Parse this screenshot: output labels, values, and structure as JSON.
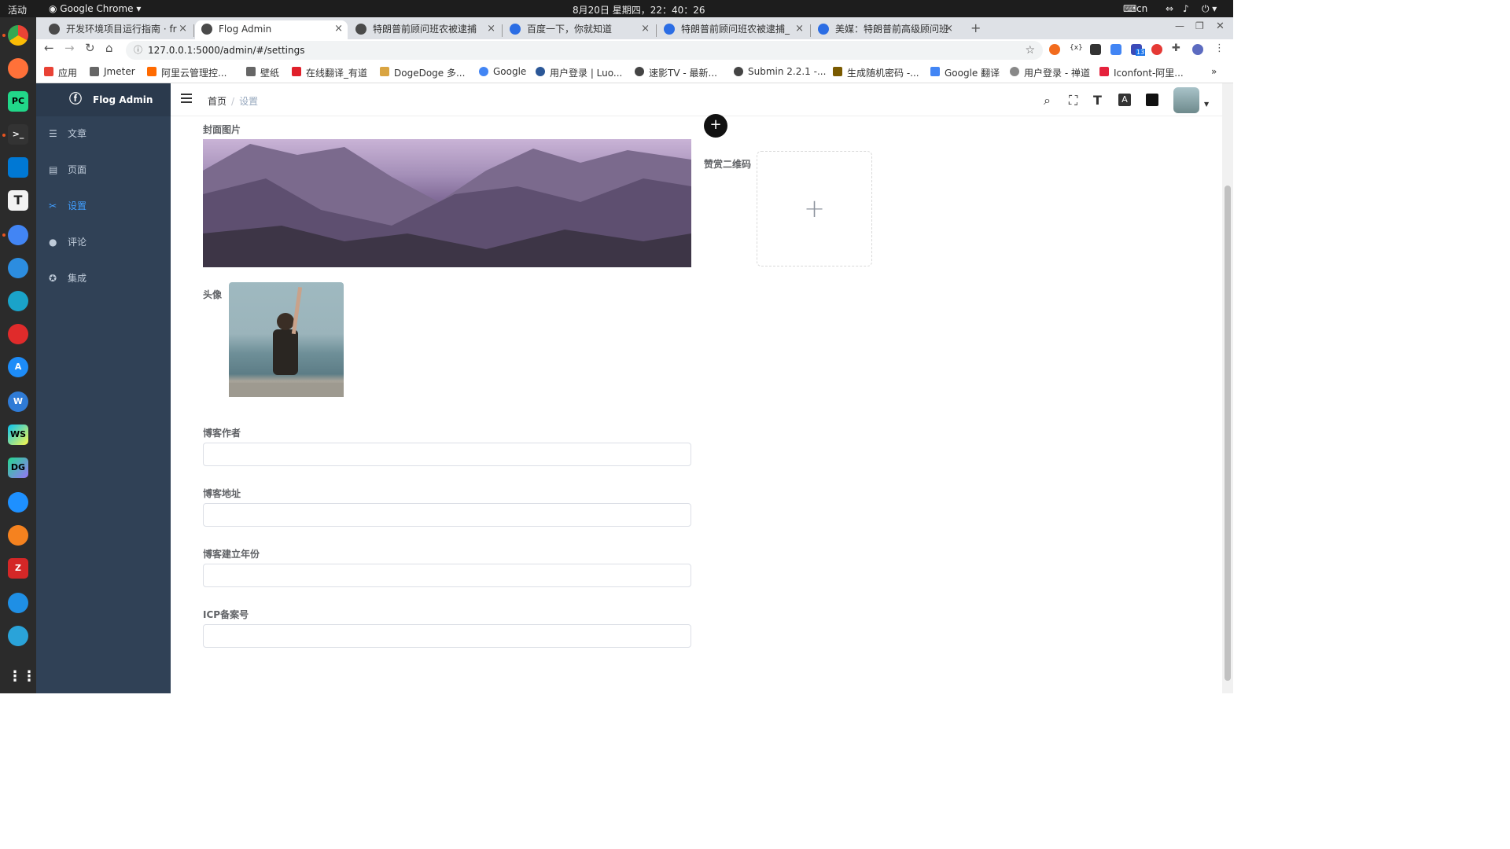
{
  "os": {
    "activities": "活动",
    "app_name": "Google Chrome",
    "clock": "8月20日 星期四，22：40：26",
    "lang": "cn"
  },
  "dock": {
    "items": [
      "chrome",
      "firefox",
      "pycharm",
      "terminal",
      "vscode",
      "typora",
      "chrome-dev",
      "baidu-netdisk",
      "app",
      "netease-music",
      "app-store",
      "webstorm-alt",
      "webstorm",
      "datagrip",
      "feishu",
      "app",
      "filezilla",
      "app",
      "app",
      "app-grid"
    ],
    "labels": {
      "pycharm": "PC",
      "webstorm": "WS",
      "datagrip": "DG",
      "typora": "T"
    }
  },
  "browser": {
    "tabs": [
      {
        "title": "开发环境项目运行指南 · fr",
        "active": false
      },
      {
        "title": "Flog Admin",
        "active": true
      },
      {
        "title": "特朗普前顾问班农被逮捕",
        "active": false
      },
      {
        "title": "百度一下，你就知道",
        "active": false
      },
      {
        "title": "特朗普前顾问班农被逮捕_",
        "active": false
      },
      {
        "title": "美媒：特朗普前高级顾问班",
        "active": false
      }
    ],
    "url": "127.0.0.1:5000/admin/#/settings",
    "bookmarks": [
      "应用",
      "Jmeter",
      "阿里云管理控...",
      "壁纸",
      "在线翻译_有道",
      "DogeDoge 多...",
      "Google",
      "用户登录 | Luo...",
      "速影TV - 最新...",
      "Submin 2.2.1 -...",
      "生成随机密码 -...",
      "Google 翻译",
      "用户登录 - 禅道",
      "Iconfont-阿里..."
    ],
    "badge": "13"
  },
  "admin": {
    "brand": "Flog Admin",
    "menu": [
      {
        "label": "文章",
        "icon": "list-icon"
      },
      {
        "label": "页面",
        "icon": "page-icon"
      },
      {
        "label": "设置",
        "icon": "tools-icon"
      },
      {
        "label": "评论",
        "icon": "comment-icon"
      },
      {
        "label": "集成",
        "icon": "integration-icon"
      }
    ],
    "breadcrumb": {
      "home": "首页",
      "sep": "/",
      "current": "设置"
    }
  },
  "settings": {
    "cover_label": "封面图片",
    "avatar_label": "头像",
    "qr_label": "赞赏二维码",
    "author_label": "博客作者",
    "author_value": "",
    "url_label": "博客地址",
    "url_value": "",
    "year_label": "博客建立年份",
    "year_value": "",
    "icp_label": "ICP备案号",
    "icp_value": ""
  },
  "colors": {
    "sidebar": "#304156",
    "active": "#409eff",
    "menu_text": "#bfcbd9"
  }
}
